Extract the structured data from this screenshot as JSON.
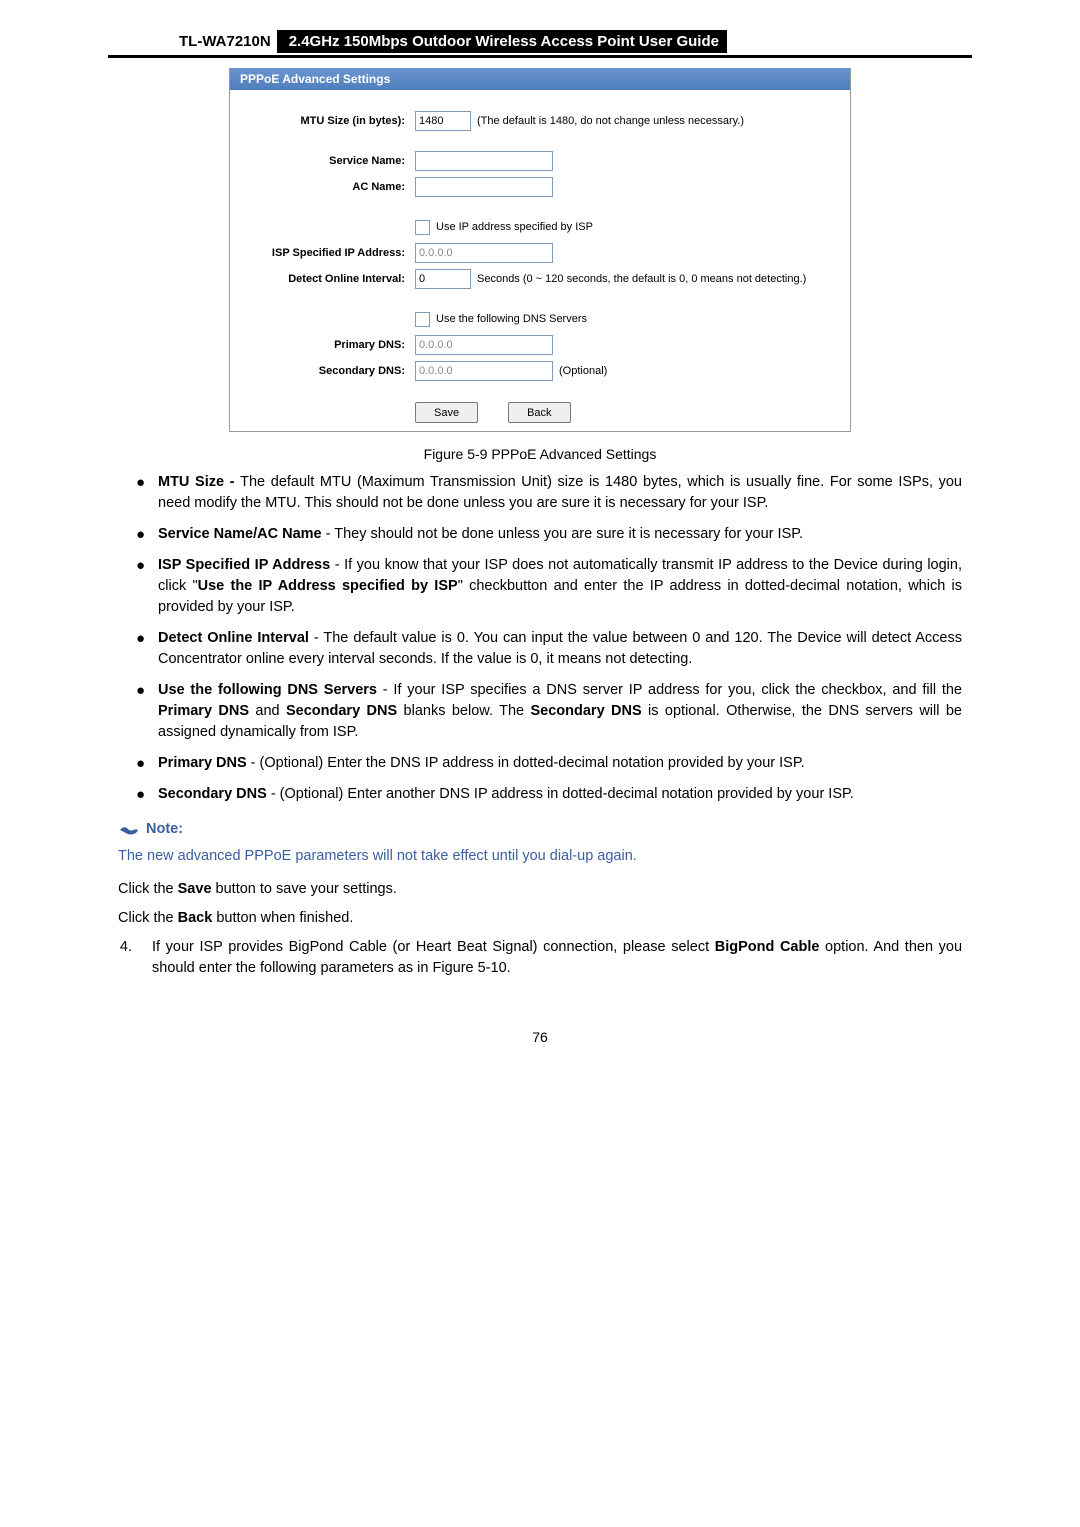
{
  "header": {
    "model": "TL-WA7210N",
    "title": "2.4GHz 150Mbps Outdoor Wireless Access Point User Guide"
  },
  "screenshot": {
    "title": "PPPoE Advanced Settings",
    "labels": {
      "mtu": "MTU Size (in bytes):",
      "serviceName": "Service Name:",
      "acName": "AC Name:",
      "useIspIp": "Use IP address specified by ISP",
      "ispIp": "ISP Specified IP Address:",
      "detectInterval": "Detect Online Interval:",
      "useDns": "Use the following DNS Servers",
      "primaryDns": "Primary DNS:",
      "secondaryDns": "Secondary DNS:"
    },
    "values": {
      "mtu": "1480",
      "mtuNote": "(The default is 1480, do not change unless necessary.)",
      "serviceName": "",
      "acName": "",
      "ispIp": "0.0.0.0",
      "detect": "0",
      "detectNote": "Seconds (0 ~ 120 seconds, the default is 0, 0 means not detecting.)",
      "primaryDns": "0.0.0.0",
      "secondaryDns": "0.0.0.0",
      "secondaryNote": "(Optional)"
    },
    "buttons": {
      "save": "Save",
      "back": "Back"
    }
  },
  "caption": "Figure 5-9 PPPoE Advanced Settings",
  "bullets": {
    "mtu": {
      "t": "MTU Size - ",
      "d": "The default MTU (Maximum Transmission Unit) size is 1480 bytes, which is usually fine. For some ISPs, you need modify the MTU. This should not be done unless you are sure it is necessary for your ISP."
    },
    "svc": {
      "t": "Service Name/AC Name",
      "d": " - They should not be done unless you are sure it is necessary for your ISP."
    },
    "ispip": {
      "t": "ISP Specified IP Address",
      "d1": " - If you know that your ISP does not automatically transmit IP address to the Device during login, click \"",
      "b1": "Use the IP Address specified by ISP",
      "d2": "\" checkbutton and enter the IP address in dotted-decimal notation, which is provided by your ISP."
    },
    "det": {
      "t": "Detect Online Interval",
      "d": " - The default value is 0. You can input the value between 0 and 120. The Device will detect Access Concentrator online every interval seconds. If the value is 0, it means not detecting."
    },
    "dns": {
      "t": "Use the following DNS Servers",
      "d1": " - If your ISP specifies a DNS server IP address for you, click the checkbox, and fill the ",
      "b1": "Primary DNS",
      "d2": " and ",
      "b2": "Secondary DNS",
      "d3": " blanks below. The ",
      "b3": "Secondary DNS",
      "d4": " is optional. Otherwise, the DNS servers will be assigned dynamically from ISP."
    },
    "pdns": {
      "t": "Primary DNS",
      "d": " - (Optional) Enter the DNS IP address in dotted-decimal notation provided by your ISP."
    },
    "sdns": {
      "t": "Secondary DNS",
      "d": " - (Optional) Enter another DNS IP address in dotted-decimal notation provided by your ISP."
    }
  },
  "noteLabel": "Note:",
  "noteText": "The new advanced PPPoE parameters will not take effect until you dial-up again.",
  "para1": {
    "a": "Click the ",
    "b": "Save",
    "c": " button to save your settings."
  },
  "para2": {
    "a": "Click the ",
    "b": "Back",
    "c": " button when finished."
  },
  "list4": {
    "a": "If your ISP provides BigPond Cable (or Heart Beat Signal) connection, please select ",
    "b": "BigPond Cable",
    "c": " option. And then you should enter the following parameters as in Figure 5-10."
  },
  "pageNum": "76"
}
